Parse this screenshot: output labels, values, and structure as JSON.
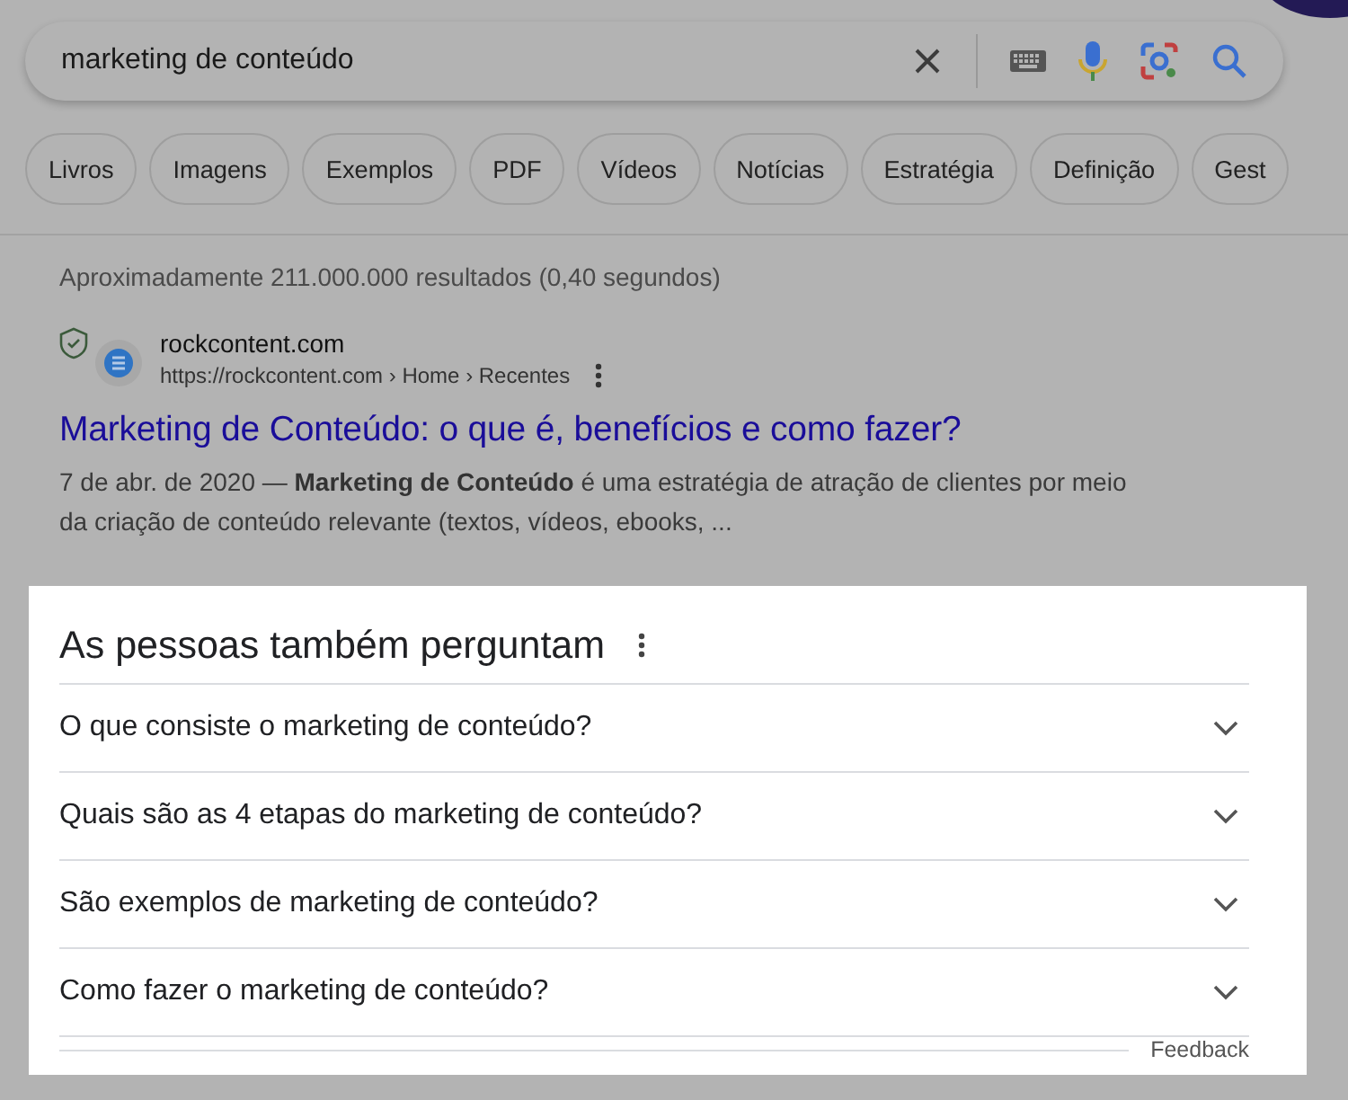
{
  "search": {
    "value": "marketing de conteúdo"
  },
  "chips": [
    {
      "label": "Livros"
    },
    {
      "label": "Imagens"
    },
    {
      "label": "Exemplos"
    },
    {
      "label": "PDF"
    },
    {
      "label": "Vídeos"
    },
    {
      "label": "Notícias"
    },
    {
      "label": "Estratégia"
    },
    {
      "label": "Definição"
    },
    {
      "label": "Gest"
    }
  ],
  "result_stats": "Aproximadamente 211.000.000 resultados (0,40 segundos)",
  "result": {
    "site": "rockcontent.com",
    "url": "https://rockcontent.com › Home › Recentes",
    "title": "Marketing de Conteúdo: o que é, benefícios e como fazer?",
    "snippet": "7 de abr. de 2020 — **Marketing de Conteúdo** é uma estratégia de atração de clientes por meio da criação de conteúdo relevante (textos, vídeos, ebooks, ..."
  },
  "people_also_ask": {
    "title": "As pessoas também perguntam",
    "questions": [
      {
        "text": "O que consiste o marketing de conteúdo?",
        "expanded": false
      },
      {
        "text": "Quais são as 4 etapas do marketing de conteúdo?",
        "expanded": false
      },
      {
        "text": "São exemplos de marketing de conteúdo?",
        "expanded": false
      },
      {
        "text": "Como fazer o marketing de conteúdo?",
        "expanded": false
      }
    ],
    "feedback": "Feedback"
  }
}
